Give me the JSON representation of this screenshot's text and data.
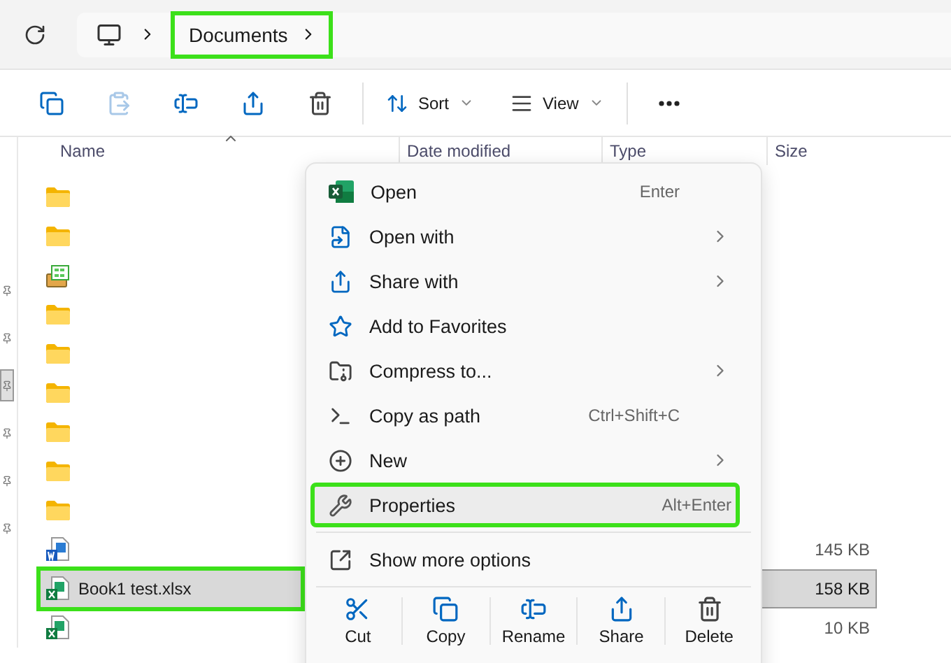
{
  "address_bar": {
    "crumbs": [
      {
        "label": "Documents",
        "highlighted": true
      }
    ]
  },
  "toolbar": {
    "sort": "Sort",
    "view": "View"
  },
  "nav_pane": {
    "items": [
      {
        "selected": false
      },
      {
        "selected": false
      },
      {
        "selected": true
      },
      {
        "selected": false
      },
      {
        "selected": false
      },
      {
        "selected": false
      }
    ]
  },
  "file_list": {
    "columns": [
      {
        "label": "Name",
        "sorted": true
      },
      {
        "label": "Date modified",
        "sorted": false
      },
      {
        "label": "Type",
        "sorted": false
      },
      {
        "label": "Size",
        "sorted": false
      }
    ],
    "rows": [
      {
        "kind": "folder",
        "selected": false,
        "highlighted": false
      },
      {
        "kind": "folder",
        "selected": false,
        "highlighted": false
      },
      {
        "kind": "app",
        "selected": false,
        "highlighted": false
      },
      {
        "kind": "folder",
        "selected": false,
        "highlighted": false
      },
      {
        "kind": "folder",
        "selected": false,
        "highlighted": false
      },
      {
        "kind": "folder",
        "selected": false,
        "highlighted": false
      },
      {
        "kind": "folder",
        "selected": false,
        "highlighted": false
      },
      {
        "kind": "folder",
        "selected": false,
        "highlighted": false
      },
      {
        "kind": "folder",
        "selected": false,
        "highlighted": false
      },
      {
        "kind": "word",
        "size": "145 KB",
        "selected": false,
        "highlighted": false
      },
      {
        "kind": "excel",
        "name": "Book1 test.xlsx",
        "size": "158 KB",
        "selected": true,
        "highlighted": true
      },
      {
        "kind": "excel",
        "size": "10 KB",
        "selected": false,
        "highlighted": false
      }
    ]
  },
  "context_menu": {
    "items": [
      {
        "label": "Open",
        "shortcut": "Enter",
        "submenu": false,
        "hovered": false,
        "highlighted": false
      },
      {
        "label": "Open with",
        "submenu": true,
        "hovered": false,
        "highlighted": false
      },
      {
        "label": "Share with",
        "submenu": true,
        "hovered": false,
        "highlighted": false
      },
      {
        "label": "Add to Favorites",
        "submenu": false,
        "hovered": false,
        "highlighted": false
      },
      {
        "label": "Compress to...",
        "submenu": true,
        "hovered": false,
        "highlighted": false
      },
      {
        "label": "Copy as path",
        "shortcut": "Ctrl+Shift+C",
        "submenu": false,
        "hovered": false,
        "highlighted": false
      },
      {
        "label": "New",
        "submenu": true,
        "hovered": false,
        "highlighted": false
      },
      {
        "label": "Properties",
        "shortcut": "Alt+Enter",
        "submenu": false,
        "hovered": true,
        "highlighted": true
      }
    ],
    "more_options": "Show more options",
    "actions": [
      "Cut",
      "Copy",
      "Rename",
      "Share",
      "Delete"
    ]
  }
}
